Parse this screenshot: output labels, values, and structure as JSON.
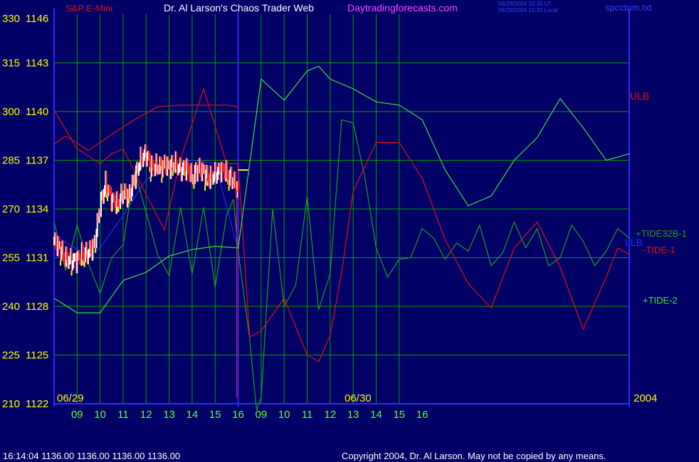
{
  "header": {
    "instrument": "S&P E-Mini",
    "site_title": "Dr. Al Larson's Chaos Trader Web",
    "site_url": "Daytradingforecasts.com",
    "stamp_line1": "06/29/2004 20:30 UT",
    "stamp_line2": "06/29/2004 15:30 Local",
    "filename": "spcctom.txt"
  },
  "footer": {
    "quote": "16:14:04  1136.00 1136.00 1136.00 1136.00",
    "copyright": "Copyright 2004, Dr. Al Larson. May not be copied by any means."
  },
  "colors": {
    "background": "#000066",
    "grid": "#00a000",
    "axis": "#2a2aff",
    "price_label": "#ffff00",
    "time_label": "#66ff33",
    "ulb": "#e01010",
    "llb": "#2929ff",
    "tide32b": "#1f9e1f",
    "tide1": "#e01010",
    "tide2": "#40e040",
    "bar_up": "#ffffff",
    "bar_down": "#ff2020",
    "bar_tail": "#ffff00",
    "magenta": "#ff44ff"
  },
  "chart_data": {
    "type": "line",
    "y_axis": {
      "cycle_ticks": [
        "330",
        "315",
        "300",
        "285",
        "270",
        "255",
        "240",
        "225",
        "210"
      ],
      "price_ticks": [
        "1146",
        "1143",
        "1140",
        "1137",
        "1134",
        "1131",
        "1128",
        "1125",
        "1122"
      ],
      "price_range": [
        1122,
        1146
      ]
    },
    "x_axis": {
      "ticks": [
        "09",
        "10",
        "11",
        "12",
        "13",
        "14",
        "15",
        "16",
        "09",
        "10",
        "11",
        "12",
        "13",
        "14",
        "15",
        "16"
      ],
      "date_labels": [
        "06/29",
        "06/30"
      ],
      "year_label": "2004",
      "range_hours": [
        8,
        33
      ]
    },
    "last_price_marker": 1136.4,
    "series": [
      {
        "name": "ULB",
        "x": [
          8.0,
          8.5,
          9.5,
          10.5,
          11.5,
          12.5,
          13.5,
          14.5,
          15.5,
          16.0
        ],
        "y": [
          1138.0,
          1138.5,
          1137.6,
          1138.6,
          1139.5,
          1140.3,
          1140.4,
          1140.4,
          1140.4,
          1140.3
        ]
      },
      {
        "name": "LLB",
        "x": [
          8.0,
          9.0,
          9.5,
          10.0,
          11.0,
          12.0,
          13.0,
          14.0,
          15.0,
          16.0
        ],
        "y": [
          1132.4,
          1131.5,
          1131.2,
          1131.6,
          1133.6,
          1135.8,
          1136.7,
          1137.0,
          1136.8,
          1131.5
        ]
      },
      {
        "name": "+TIDE32B-1",
        "x": [
          8.0,
          8.5,
          9.0,
          9.5,
          10.0,
          10.5,
          11.0,
          11.5,
          12.0,
          12.5,
          13.0,
          13.5,
          14.0,
          14.5,
          15.0,
          15.5,
          15.8,
          16.0,
          16.5,
          16.8,
          17.0,
          17.5,
          18.0,
          18.5,
          19.0,
          19.5,
          20.0,
          20.5,
          21.0,
          21.5,
          22.0,
          22.5,
          23.0,
          23.5,
          24.0,
          24.5,
          25.0,
          25.5,
          26.0,
          26.5,
          27.0,
          27.5,
          28.0,
          28.5,
          29.0,
          29.5,
          30.0,
          30.5,
          31.0,
          31.5,
          32.0,
          32.5,
          33.0
        ],
        "y": [
          1133.2,
          1130.2,
          1133.0,
          1130.6,
          1128.8,
          1131.0,
          1131.8,
          1136.3,
          1133.8,
          1131.2,
          1129.9,
          1134.1,
          1130.0,
          1134.1,
          1129.2,
          1133.6,
          1134.6,
          1131.4,
          1126.0,
          1121.6,
          1122.4,
          1134.0,
          1128.0,
          1129.3,
          1134.8,
          1127.8,
          1130.0,
          1139.5,
          1139.3,
          1136.0,
          1131.6,
          1129.8,
          1130.9,
          1131.0,
          1132.8,
          1132.2,
          1130.9,
          1131.9,
          1131.4,
          1133.0,
          1130.5,
          1131.3,
          1133.2,
          1131.6,
          1132.8,
          1130.5,
          1131.0,
          1133.0,
          1132.0,
          1130.5,
          1131.4,
          1132.8,
          1132.2
        ]
      },
      {
        "name": "-TIDE-1",
        "x": [
          8.0,
          9.0,
          10.0,
          10.5,
          11.0,
          12.0,
          12.8,
          13.5,
          14.5,
          15.5,
          16.0,
          16.5,
          17.0,
          18.0,
          19.0,
          19.5,
          20.0,
          20.5,
          21.0,
          22.0,
          23.0,
          24.0,
          25.0,
          26.0,
          27.0,
          28.0,
          29.0,
          30.0,
          31.0,
          32.0,
          32.5,
          33.0
        ],
        "y": [
          1140.1,
          1137.7,
          1136.8,
          1137.4,
          1137.7,
          1134.9,
          1132.7,
          1137.1,
          1141.4,
          1136.8,
          1136.8,
          1126.1,
          1126.5,
          1128.5,
          1125.0,
          1124.6,
          1126.2,
          1130.1,
          1135.1,
          1138.1,
          1138.1,
          1135.9,
          1132.1,
          1129.4,
          1127.9,
          1131.6,
          1133.2,
          1130.4,
          1126.6,
          1129.8,
          1131.6,
          1131.2
        ]
      },
      {
        "name": "+TIDE-2",
        "x": [
          8.0,
          9.0,
          10.0,
          11.0,
          12.0,
          13.0,
          14.0,
          15.0,
          16.0,
          17.0,
          18.0,
          19.0,
          19.5,
          20.0,
          21.0,
          22.0,
          23.0,
          24.0,
          25.0,
          26.0,
          27.0,
          28.0,
          29.0,
          30.0,
          31.0,
          32.0,
          33.0
        ],
        "y": [
          1128.5,
          1127.6,
          1127.6,
          1129.6,
          1130.1,
          1131.1,
          1131.5,
          1131.7,
          1131.6,
          1142.0,
          1140.7,
          1142.5,
          1142.8,
          1142.0,
          1141.4,
          1140.6,
          1140.4,
          1139.5,
          1136.4,
          1134.2,
          1134.8,
          1137.0,
          1138.4,
          1140.8,
          1139.0,
          1137.0,
          1137.4
        ]
      },
      {
        "name": "S&P E-Mini",
        "x": [
          8.0,
          8.25,
          8.5,
          8.75,
          9.0,
          9.25,
          9.5,
          9.75,
          10.0,
          10.25,
          10.5,
          10.75,
          11.0,
          11.25,
          11.5,
          11.75,
          12.0,
          12.25,
          12.5,
          12.75,
          13.0,
          13.25,
          13.5,
          13.75,
          14.0,
          14.25,
          14.5,
          14.75,
          15.0,
          15.25,
          15.5,
          15.75,
          16.0
        ],
        "y": [
          1132.0,
          1131.6,
          1131.0,
          1130.8,
          1130.9,
          1131.2,
          1131.3,
          1131.8,
          1134.2,
          1135.6,
          1134.6,
          1134.3,
          1135.0,
          1134.8,
          1135.9,
          1137.0,
          1137.4,
          1136.6,
          1136.6,
          1136.7,
          1136.6,
          1136.8,
          1136.4,
          1136.6,
          1135.9,
          1136.5,
          1136.3,
          1135.9,
          1136.1,
          1136.5,
          1136.2,
          1135.8,
          1135.2
        ]
      }
    ],
    "series_labels": [
      "ULB",
      "LLB",
      "+TIDE32B-1",
      "-TIDE-1",
      "+TIDE-2"
    ]
  }
}
